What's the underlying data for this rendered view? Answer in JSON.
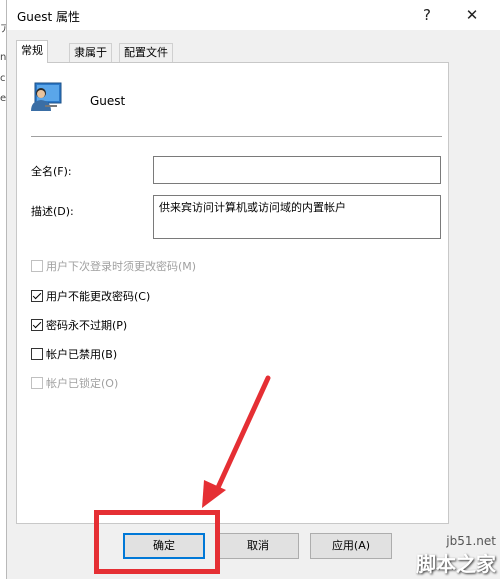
{
  "background": {
    "edge_chars": [
      "ア",
      "ni",
      "ce",
      "es"
    ]
  },
  "dialog": {
    "title": "Guest 属性",
    "help_glyph": "?",
    "close_glyph": "✕"
  },
  "tabs": [
    {
      "label": "常规",
      "active": true
    },
    {
      "label": "隶属于",
      "active": false
    },
    {
      "label": "配置文件",
      "active": false
    }
  ],
  "general": {
    "user_icon": "user-account-icon",
    "user_name": "Guest",
    "fullname_label": "全名(F):",
    "fullname_value": "",
    "description_label": "描述(D):",
    "description_value": "供来宾访问计算机或访问域的内置帐户",
    "checkboxes": [
      {
        "label": "用户下次登录时须更改密码(M)",
        "checked": false,
        "disabled": true
      },
      {
        "label": "用户不能更改密码(C)",
        "checked": true,
        "disabled": false
      },
      {
        "label": "密码永不过期(P)",
        "checked": true,
        "disabled": false
      },
      {
        "label": "帐户已禁用(B)",
        "checked": false,
        "disabled": false
      },
      {
        "label": "帐户已锁定(O)",
        "checked": false,
        "disabled": true
      }
    ]
  },
  "buttons": {
    "ok": "确定",
    "cancel": "取消",
    "apply": "应用(A)"
  },
  "annotation": {
    "color": "#e52f34"
  },
  "watermark": {
    "url": "jb51.net",
    "site": "脚本之家"
  }
}
